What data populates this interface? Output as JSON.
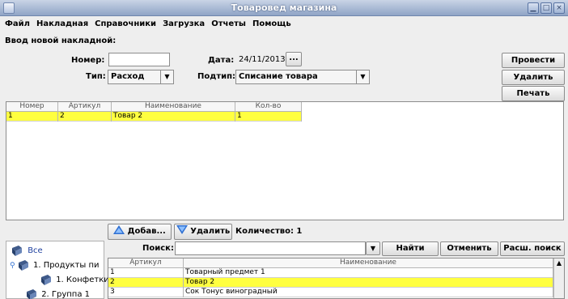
{
  "window": {
    "title": "Товаровед магазина"
  },
  "menu": [
    "Файл",
    "Накладная",
    "Справочники",
    "Загрузка",
    "Отчеты",
    "Помощь"
  ],
  "form": {
    "heading": "Ввод новой накладной:",
    "number_label": "Номер:",
    "number_value": "",
    "date_label": "Дата:",
    "date_value": "24/11/2013",
    "date_button": "...",
    "type_label": "Тип:",
    "type_value": "Расход",
    "subtype_label": "Подтип:",
    "subtype_value": "Списание товара"
  },
  "actions": {
    "post": "Провести",
    "delete": "Удалить",
    "print": "Печать"
  },
  "invoice_table": {
    "columns": [
      "Номер",
      "Артикул",
      "Наименование",
      "Кол-во"
    ],
    "rows": [
      [
        "1",
        "2",
        "Товар 2",
        "1"
      ]
    ]
  },
  "toolbar": {
    "add": "Добав...",
    "remove": "Удалить",
    "count": "Количество: 1"
  },
  "search": {
    "label": "Поиск:",
    "value": "",
    "find": "Найти",
    "cancel": "Отменить",
    "extended": "Расш. поиск"
  },
  "tree": [
    "Все",
    "1. Продукты пи",
    "1. Конфетки",
    "2. Группа 1"
  ],
  "catalog_table": {
    "columns": [
      "Артикул",
      "Наименование"
    ],
    "rows": [
      [
        "1",
        "Товарный предмет 1"
      ],
      [
        "2",
        "Товар 2"
      ],
      [
        "3",
        "Сок Тонус виноградный"
      ]
    ]
  },
  "colors": {
    "selection": "#ffff40",
    "titlebar": "#8fa4c6",
    "icon_blue": "#2f6fd1"
  }
}
